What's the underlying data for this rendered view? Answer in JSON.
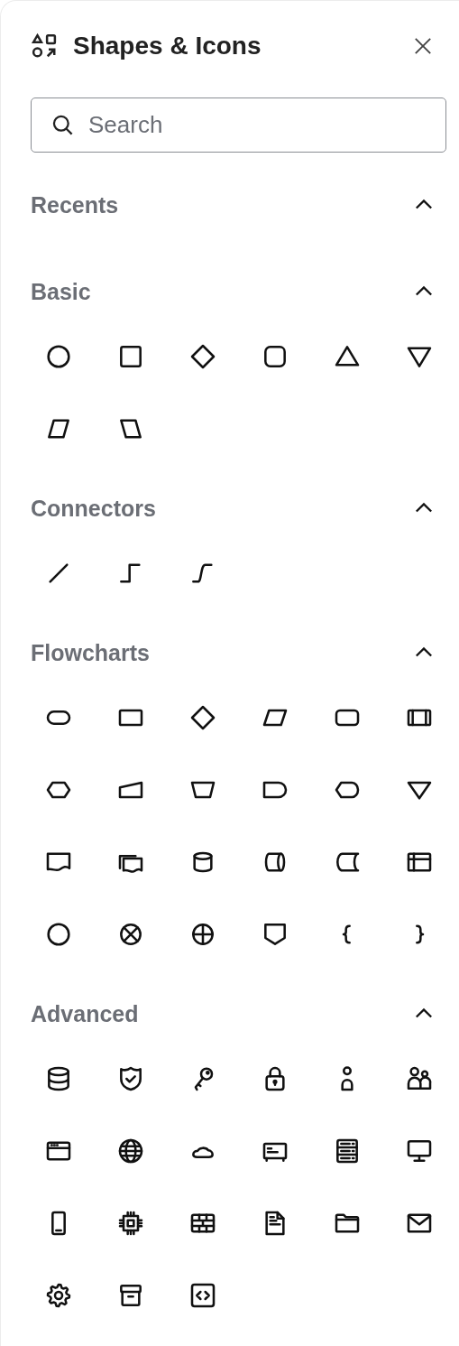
{
  "panel": {
    "title": "Shapes & Icons"
  },
  "search": {
    "placeholder": "Search"
  },
  "sections": [
    {
      "title": "Recents",
      "expanded": true
    },
    {
      "title": "Basic",
      "expanded": true,
      "items": [
        {
          "kind": "circle"
        },
        {
          "kind": "square"
        },
        {
          "kind": "diamond"
        },
        {
          "kind": "rounded-square"
        },
        {
          "kind": "triangle"
        },
        {
          "kind": "inverted-triangle"
        },
        {
          "kind": "parallelogram"
        },
        {
          "kind": "reverse-parallelogram"
        }
      ]
    },
    {
      "title": "Connectors",
      "expanded": true,
      "items": [
        {
          "kind": "straight-line"
        },
        {
          "kind": "elbow-connector"
        },
        {
          "kind": "curved-connector"
        }
      ]
    },
    {
      "title": "Flowcharts",
      "expanded": true,
      "items": [
        {
          "kind": "terminator"
        },
        {
          "kind": "process"
        },
        {
          "kind": "decision"
        },
        {
          "kind": "data"
        },
        {
          "kind": "alternate-process"
        },
        {
          "kind": "predefined-process"
        },
        {
          "kind": "preparation"
        },
        {
          "kind": "manual-input"
        },
        {
          "kind": "manual-operation"
        },
        {
          "kind": "delay"
        },
        {
          "kind": "display"
        },
        {
          "kind": "merge"
        },
        {
          "kind": "document"
        },
        {
          "kind": "multi-document"
        },
        {
          "kind": "stored-database"
        },
        {
          "kind": "direct-access"
        },
        {
          "kind": "stored-data"
        },
        {
          "kind": "internal-storage"
        },
        {
          "kind": "connector"
        },
        {
          "kind": "summing-junction"
        },
        {
          "kind": "or"
        },
        {
          "kind": "off-page"
        },
        {
          "kind": "left-brace"
        },
        {
          "kind": "right-brace"
        }
      ]
    },
    {
      "title": "Advanced",
      "expanded": true,
      "items": [
        {
          "kind": "database"
        },
        {
          "kind": "shield"
        },
        {
          "kind": "key"
        },
        {
          "kind": "lock"
        },
        {
          "kind": "user"
        },
        {
          "kind": "users"
        },
        {
          "kind": "browser"
        },
        {
          "kind": "globe"
        },
        {
          "kind": "cloud"
        },
        {
          "kind": "terminal"
        },
        {
          "kind": "server"
        },
        {
          "kind": "monitor"
        },
        {
          "kind": "mobile"
        },
        {
          "kind": "chip"
        },
        {
          "kind": "firewall"
        },
        {
          "kind": "file"
        },
        {
          "kind": "folder"
        },
        {
          "kind": "mail"
        },
        {
          "kind": "gear"
        },
        {
          "kind": "archive"
        },
        {
          "kind": "code"
        }
      ]
    }
  ]
}
